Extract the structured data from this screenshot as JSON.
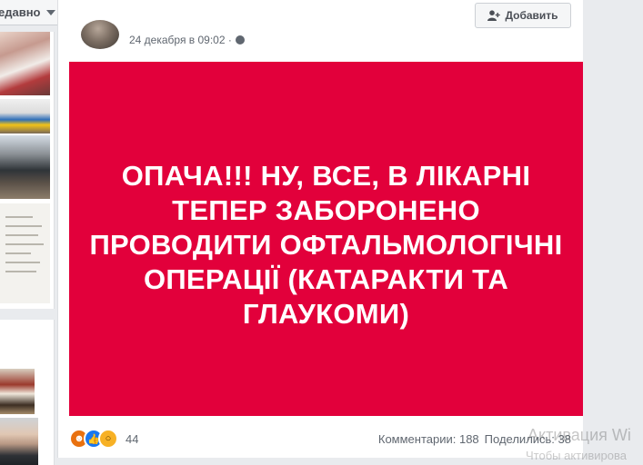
{
  "left_column": {
    "sort_label": "едавно"
  },
  "post": {
    "timestamp": "24 декабря в 09:02 ·",
    "add_button_label": "Добавить",
    "banner_text": "ОПАЧА!!! НУ, ВСЕ, В ЛІКАРНІ ТЕПЕР ЗАБОРОНЕНО ПРОВОДИТИ ОФТАЛЬМОЛОГІЧНІ ОПЕРАЦІЇ (КАТАРАКТИ ТА ГЛАУКОМИ)",
    "banner_color": "#e2003b",
    "reactions": {
      "icons": [
        "angry-icon",
        "like-icon",
        "wow-icon"
      ],
      "count": "44"
    },
    "comments_label": "Комментарии: 188",
    "shares_label": "Поделились: 38"
  },
  "watermark": {
    "line1": "Активация Wi",
    "line2": "Чтобы активирова"
  }
}
